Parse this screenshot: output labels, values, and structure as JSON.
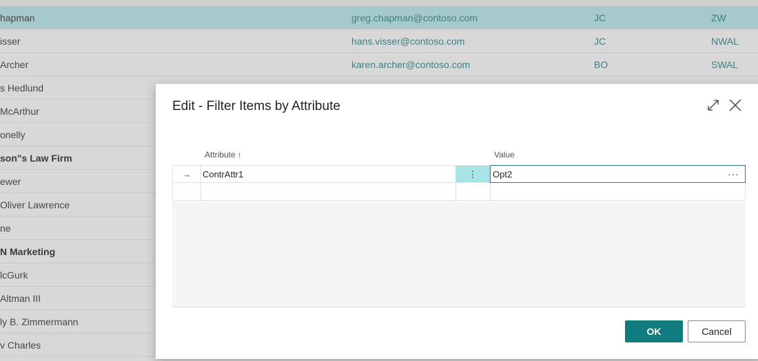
{
  "background_list": {
    "rows": [
      {
        "name": "hapman",
        "email": "greg.chapman@contoso.com",
        "code1": "JC",
        "code2": "ZW",
        "selected": true,
        "bold": false
      },
      {
        "name": "isser",
        "email": "hans.visser@contoso.com",
        "code1": "JC",
        "code2": "NWAL",
        "selected": false,
        "bold": false
      },
      {
        "name": "Archer",
        "email": "karen.archer@contoso.com",
        "code1": "BO",
        "code2": "SWAL",
        "selected": false,
        "bold": false
      },
      {
        "name": "s Hedlund",
        "email": "",
        "code1": "",
        "code2": "",
        "selected": false,
        "bold": false
      },
      {
        "name": "McArthur",
        "email": "",
        "code1": "",
        "code2": "",
        "selected": false,
        "bold": false
      },
      {
        "name": "onelly",
        "email": "",
        "code1": "",
        "code2": "",
        "selected": false,
        "bold": false
      },
      {
        "name": "son\"s Law Firm",
        "email": "",
        "code1": "",
        "code2": "",
        "selected": false,
        "bold": true
      },
      {
        "name": "ewer",
        "email": "",
        "code1": "",
        "code2": "",
        "selected": false,
        "bold": false
      },
      {
        "name": "Oliver Lawrence",
        "email": "",
        "code1": "",
        "code2": "",
        "selected": false,
        "bold": false
      },
      {
        "name": "ne",
        "email": "",
        "code1": "",
        "code2": "",
        "selected": false,
        "bold": false
      },
      {
        "name": "N Marketing",
        "email": "",
        "code1": "",
        "code2": "",
        "selected": false,
        "bold": true
      },
      {
        "name": "lcGurk",
        "email": "",
        "code1": "",
        "code2": "",
        "selected": false,
        "bold": false
      },
      {
        "name": " Altman III",
        "email": "",
        "code1": "",
        "code2": "",
        "selected": false,
        "bold": false
      },
      {
        "name": "ly B. Zimmermann",
        "email": "",
        "code1": "",
        "code2": "",
        "selected": false,
        "bold": false
      },
      {
        "name": "v Charles",
        "email": "",
        "code1": "",
        "code2": "",
        "selected": false,
        "bold": false
      }
    ]
  },
  "dialog": {
    "title": "Edit - Filter Items by Attribute",
    "icons": {
      "expand": "expand-icon",
      "close": "close-icon"
    },
    "grid": {
      "columns": {
        "attribute": "Attribute",
        "value": "Value",
        "attribute_sort": "ascending"
      },
      "rows": [
        {
          "indicator": "→",
          "attribute": "ContrAttr1",
          "menu": "⋮",
          "value": "Opt2",
          "value_action": "···"
        },
        {
          "indicator": "",
          "attribute": "",
          "menu": "",
          "value": "",
          "value_action": ""
        }
      ]
    },
    "buttons": {
      "ok": "OK",
      "cancel": "Cancel"
    }
  },
  "colors": {
    "accent": "#107c80",
    "selected_row": "#a6c9cb",
    "menu_cell": "#a8e3e6"
  }
}
